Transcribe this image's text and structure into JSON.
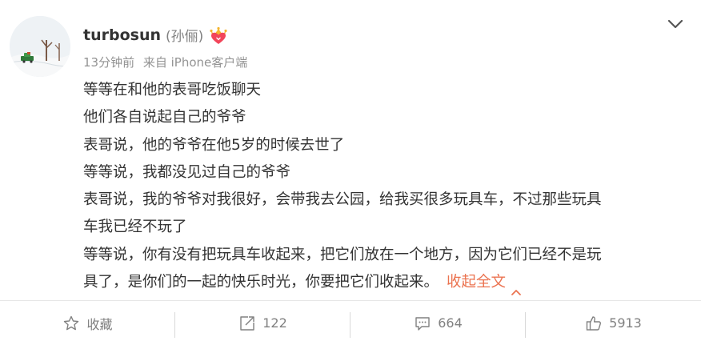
{
  "user": {
    "username": "turbosun",
    "realname": "(孙俪)",
    "badge_icon": "crown-heart-badge-icon",
    "avatar_icon": "snow-landscape-avatar"
  },
  "meta": {
    "time": "13分钟前",
    "source": "来自 iPhone客户端"
  },
  "content": {
    "lines": [
      "等等在和他的表哥吃饭聊天",
      "他们各自说起自己的爷爷",
      "表哥说，他的爷爷在他5岁的时候去世了",
      "等等说，我都没见过自己的爷爷",
      "表哥说，我的爷爷对我很好，会带我去公园，给我买很多玩具车，不过那些玩具",
      "车我已经不玩了",
      "等等说，你有没有把玩具车收起来，把它们放在一个地方，因为它们已经不是玩",
      "具了，是你们的一起的快乐时光，你要把它们收起来。"
    ],
    "collapse_label": "收起全文"
  },
  "actions": {
    "favorite": "收藏",
    "repost": "122",
    "comment": "664",
    "like": "5913"
  },
  "colors": {
    "accent": "#eb7350",
    "text": "#333333",
    "muted": "#939393"
  }
}
